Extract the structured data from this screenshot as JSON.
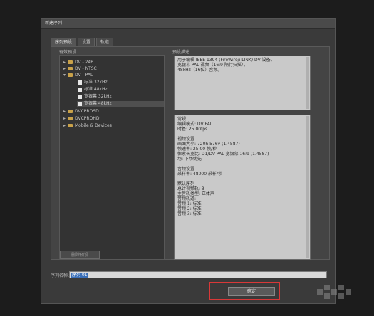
{
  "window": {
    "title": "新建序列"
  },
  "tabs": [
    {
      "label": "序列预设",
      "active": true
    },
    {
      "label": "设置",
      "active": false
    },
    {
      "label": "轨道",
      "active": false
    }
  ],
  "presets": {
    "label": "有效预设",
    "items": [
      {
        "label": "DV - 24P",
        "type": "folder",
        "expanded": false
      },
      {
        "label": "DV - NTSC",
        "type": "folder",
        "expanded": false
      },
      {
        "label": "DV - PAL",
        "type": "folder",
        "expanded": true
      },
      {
        "label": "标准 32kHz",
        "type": "file"
      },
      {
        "label": "标准 48kHz",
        "type": "file"
      },
      {
        "label": "宽银幕 32kHz",
        "type": "file"
      },
      {
        "label": "宽银幕 48kHz",
        "type": "file",
        "selected": true
      },
      {
        "label": "DVCPROSD",
        "type": "folder",
        "expanded": false
      },
      {
        "label": "DVCPROHD",
        "type": "folder",
        "expanded": false
      },
      {
        "label": "Mobile & Devices",
        "type": "folder",
        "expanded": false
      }
    ],
    "delete_label": "删除预设"
  },
  "description": {
    "label": "预设描述",
    "lines": [
      "用于编辑 IEEE 1394 (FireWire/i.LINK) DV 设备。",
      "宽银幕 PAL 视频（16:9 隔行扫描）。",
      "48kHz（16位）音频。"
    ]
  },
  "general": {
    "lines": [
      "常规",
      "  编辑模式: DV PAL",
      "  时基: 25.00fps",
      "",
      "视频设置",
      "  画面大小: 720h 576v (1.4587)",
      "  帧速率: 25.00 帧/秒",
      "  像素长宽比: D1/DV PAL 宽银幕 16:9 (1.4587)",
      "  场: 下场优先",
      "",
      "音频设置",
      "  采样率: 48000 采样/秒",
      "",
      "默认序列",
      "  总计视频轨: 3",
      "  主音轨类型: 立体声",
      "  音频轨道:",
      "  音频 1: 标准",
      "  音频 2: 标准",
      "  音频 3: 标准"
    ]
  },
  "sequence_name": {
    "label": "序列名称:",
    "value": "序列 01"
  },
  "ok_button": {
    "label": "确定"
  },
  "colors": {
    "dialog_bg": "#3a3a3a",
    "highlight": "#d93838",
    "selection": "#3a6fb8",
    "folder": "#c9a24a"
  }
}
